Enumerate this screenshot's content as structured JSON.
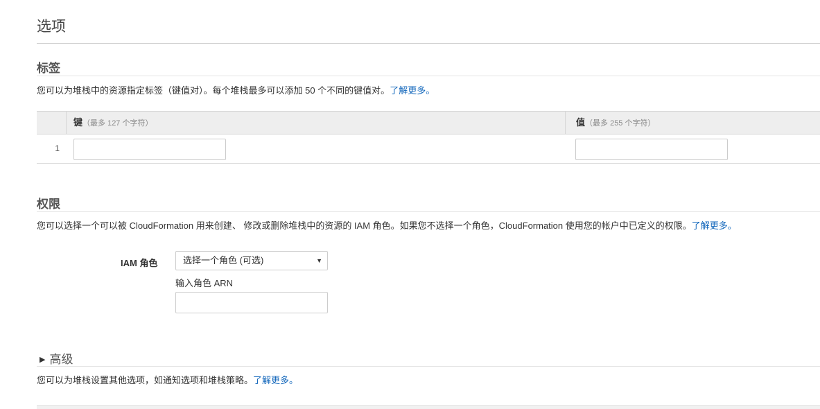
{
  "page_title": "选项",
  "tags": {
    "title": "标签",
    "description": "您可以为堆栈中的资源指定标签（键值对）。每个堆栈最多可以添加 50 个不同的键值对。",
    "learn_more": "了解更多。",
    "key_header": "键",
    "key_hint": "（最多 127 个字符）",
    "value_header": "值",
    "value_hint": "（最多 255 个字符）",
    "rows": [
      {
        "num": "1",
        "key": "",
        "value": ""
      }
    ]
  },
  "permissions": {
    "title": "权限",
    "description": "您可以选择一个可以被 CloudFormation 用来创建、 修改或删除堆栈中的资源的 IAM 角色。如果您不选择一个角色，CloudFormation 使用您的帐户中已定义的权限。",
    "learn_more": "了解更多。",
    "iam_role_label": "IAM 角色",
    "iam_role_select": "选择一个角色 (可选)",
    "arn_label": "输入角色 ARN",
    "arn_value": ""
  },
  "advanced": {
    "title": "高级",
    "description": "您可以为堆栈设置其他选项，如通知选项和堆栈策略。",
    "learn_more": "了解更多。"
  },
  "icons": {
    "select_caret": "▼",
    "expand_triangle": "▶"
  }
}
